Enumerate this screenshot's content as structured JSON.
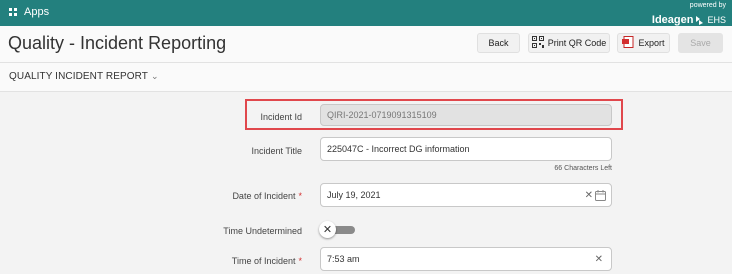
{
  "topbar": {
    "apps_label": "Apps",
    "powered_by": "powered by",
    "brand": "Ideagen",
    "brand_suffix": "EHS"
  },
  "header": {
    "title": "Quality - Incident Reporting",
    "back_label": "Back",
    "print_qr_label": "Print QR Code",
    "export_label": "Export",
    "save_label": "Save"
  },
  "section": {
    "title": "QUALITY INCIDENT REPORT",
    "chevron": "⌄"
  },
  "form": {
    "incident_id": {
      "label": "Incident Id",
      "value": "QIRI-2021-0719091315109"
    },
    "incident_title": {
      "label": "Incident Title",
      "value": "225047C - Incorrect DG information",
      "hint": "66 Characters Left"
    },
    "date_of_incident": {
      "label": "Date of Incident",
      "value": "July 19, 2021",
      "required": "*"
    },
    "time_undetermined": {
      "label": "Time Undetermined",
      "state": "off"
    },
    "time_of_incident": {
      "label": "Time of Incident",
      "value": "7:53 am",
      "required": "*"
    }
  },
  "colors": {
    "topbar": "#23807e",
    "highlight": "#e0474c",
    "required": "#d32f2f"
  },
  "icons": [
    "apps-grid-icon",
    "ideagen-logo-icon",
    "qr-code-icon",
    "pdf-export-icon",
    "chevron-down-icon",
    "clear-icon",
    "calendar-icon",
    "toggle-x-icon"
  ]
}
